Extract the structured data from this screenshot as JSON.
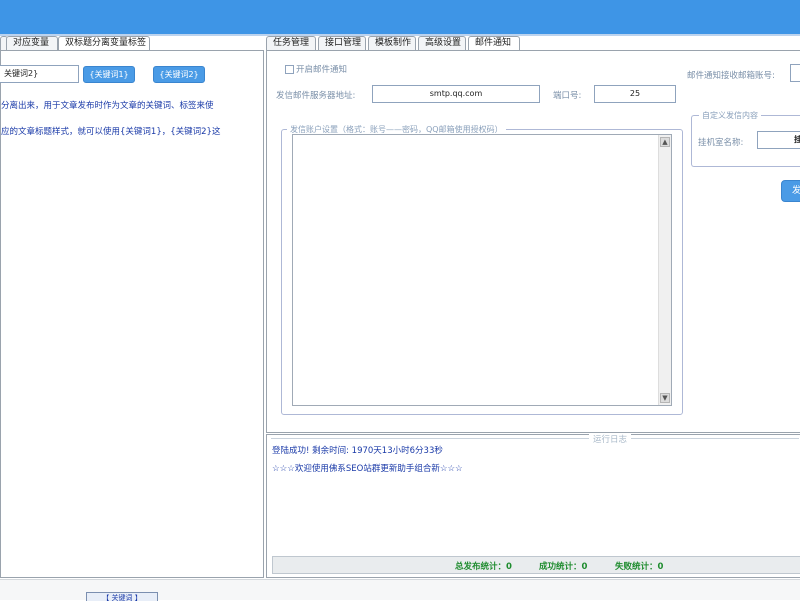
{
  "left_tabs": [
    {
      "label": "对应变量",
      "active": false
    },
    {
      "label": "双标题分离变量标签",
      "active": true
    }
  ],
  "right_tabs": [
    {
      "label": "任务管理",
      "active": false
    },
    {
      "label": "接口管理",
      "active": false
    },
    {
      "label": "模板制作",
      "active": false
    },
    {
      "label": "高级设置",
      "active": false
    },
    {
      "label": "邮件通知",
      "active": true
    }
  ],
  "left_panel": {
    "input_value": "关键词2}",
    "btn1_label": "{关键词1}",
    "btn2_label": "{关键词2}",
    "desc_line1": "分离出来，用于文章发布时作为文章的关键词、标签来使",
    "desc_line2": "应的文章标题样式，就可以使用{关键词1}，{关键词2}这"
  },
  "email": {
    "enable_label": "开启邮件通知",
    "server_label": "发信邮件服务器地址:",
    "server_value": "smtp.qq.com",
    "port_label": "端口号:",
    "port_value": "25",
    "account_legend": "发信账户设置（格式：账号——密码，QQ邮箱使用授权码）",
    "recv_label": "邮件通知接收邮箱账号:",
    "custom_legend": "自定义发信内容",
    "machine_label": "挂机室名称:",
    "machine_value": "挂",
    "send_label": "发"
  },
  "log": {
    "title": "运行日志",
    "lines": [
      "登陆成功! 剩余时间: 1970天13小时6分33秒",
      "☆☆☆欢迎使用佛系SEO站群更新助手组合新☆☆☆"
    ],
    "stats": [
      {
        "label": "总发布统计：",
        "value": "0"
      },
      {
        "label": "成功统计：",
        "value": "0"
      },
      {
        "label": "失败统计：",
        "value": "0"
      }
    ]
  },
  "bottom": {
    "label": "【 关键词 】"
  }
}
